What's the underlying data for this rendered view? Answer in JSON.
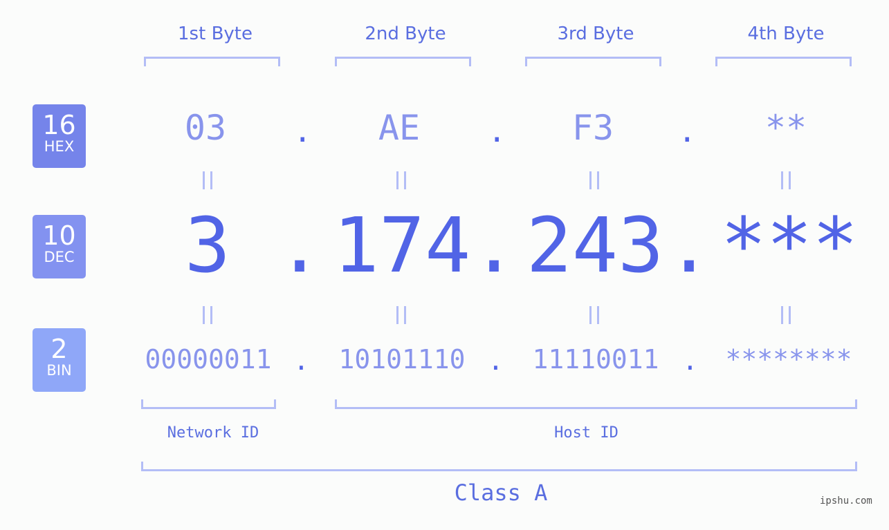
{
  "bytes": [
    {
      "label": "1st Byte",
      "hex": "03",
      "dec": "3",
      "bin": "00000011"
    },
    {
      "label": "2nd Byte",
      "hex": "AE",
      "dec": "174",
      "bin": "10101110"
    },
    {
      "label": "3rd Byte",
      "hex": "F3",
      "dec": "243",
      "bin": "11110011"
    },
    {
      "label": "4th Byte",
      "hex": "**",
      "dec": "***",
      "bin": "********"
    }
  ],
  "separator": ".",
  "badges": {
    "hex": {
      "num": "16",
      "label": "HEX",
      "color": "#7584ea"
    },
    "dec": {
      "num": "10",
      "label": "DEC",
      "color": "#8392f0"
    },
    "bin": {
      "num": "2",
      "label": "BIN",
      "color": "#8fa7f8"
    }
  },
  "network_id_label": "Network ID",
  "host_id_label": "Host ID",
  "class_label": "Class A",
  "watermark": "ipshu.com"
}
